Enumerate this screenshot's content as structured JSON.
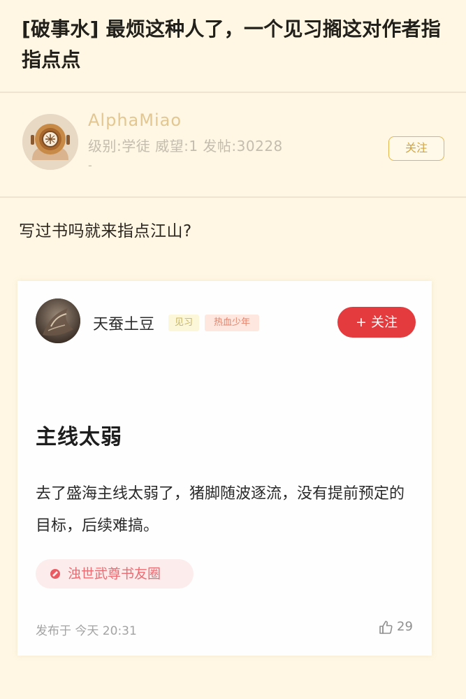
{
  "thread": {
    "title": "[破事水] 最烦这种人了，一个见习搁这对作者指指点点"
  },
  "author": {
    "name": "AlphaMiao",
    "meta": "级别:学徒 威望:1 发帖:30228",
    "extra": "-",
    "follow_label": "关注"
  },
  "post": {
    "text": "写过书吗就来指点江山?"
  },
  "embedded": {
    "username": "天蚕土豆",
    "level_badge": "见习",
    "tag_badge": "热血少年",
    "follow_label": "+ 关注",
    "title": "主线太弱",
    "body": "去了盛海主线太弱了，猪脚随波逐流，没有提前预定的目标，后续难搞。",
    "circle": "浊世武尊书友圈",
    "time": "发布于 今天 20:31",
    "likes": "29"
  },
  "colors": {
    "background": "#fff7e3",
    "accent_gold": "#e3b64c",
    "follow_red": "#e33b3e",
    "circle_pink": "#ec6b72"
  },
  "icons": {
    "author_avatar": "diving-helmet-avatar",
    "embed_avatar": "user-avatar",
    "circle_icon": "book-circle-icon",
    "like_icon": "thumbs-up-icon"
  }
}
